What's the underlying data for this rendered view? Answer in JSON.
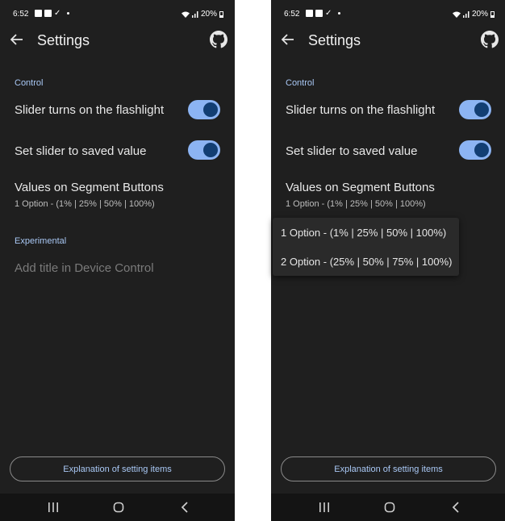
{
  "status_bar": {
    "time": "6:52",
    "battery": "20%"
  },
  "app_bar": {
    "title": "Settings",
    "back_icon": "arrow-left-icon",
    "github_icon": "github-icon"
  },
  "sections": {
    "control_header": "Control",
    "experimental_header": "Experimental"
  },
  "preferences": {
    "flashlight_title": "Slider turns on the flashlight",
    "flashlight_on": true,
    "saved_value_title": "Set slider to saved value",
    "saved_value_on": true,
    "segment_title": "Values on Segment Buttons",
    "segment_summary": "1 Option - (1% | 25% | 50% | 100%)",
    "device_control_title": "Add title in Device Control"
  },
  "popup": {
    "options": [
      "1 Option - (1% | 25% | 50% | 100%)",
      "2 Option - (25% | 50% | 75% | 100%)"
    ]
  },
  "footer": {
    "explain_label": "Explanation of setting items"
  },
  "colors": {
    "background": "#1f1f1f",
    "accent": "#a9c8f5",
    "switch_track": "#8cb4f3",
    "switch_thumb": "#123e73"
  }
}
